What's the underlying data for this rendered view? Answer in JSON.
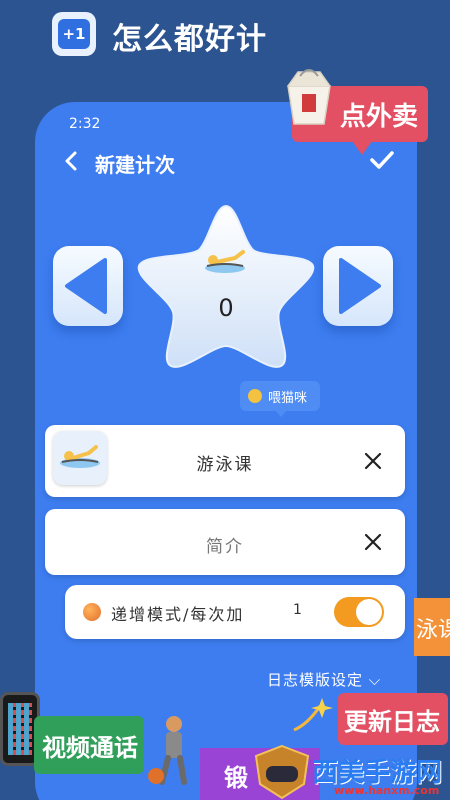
{
  "app": {
    "logo_text": "+1",
    "title": "怎么都好计"
  },
  "phone": {
    "status_time": "2:32",
    "nav": {
      "title": "新建计次"
    },
    "counter": {
      "emoji": "swimmer",
      "value": "0"
    },
    "tooltip": {
      "text": "喂猫咪"
    },
    "name_field": {
      "value": "游泳课"
    },
    "intro_field": {
      "placeholder": "简介"
    },
    "increment": {
      "label": "递增模式/每次加",
      "value": "1",
      "enabled": true
    },
    "log_settings": "日志模版设定 ⌵"
  },
  "promos": {
    "takeout": "点外卖",
    "swim_class_partial": "泳课",
    "update_log": "更新日志",
    "video_call": "视频通话",
    "exercise_partial": "锻"
  },
  "watermark": {
    "name": "西美手游网",
    "url": "www.hanxm.com"
  },
  "colors": {
    "background": "#2c5491",
    "phone": "#3d7df0",
    "toggle": "#f39a20",
    "promo_red": "#e34f63",
    "promo_green": "#2f9f5a"
  }
}
